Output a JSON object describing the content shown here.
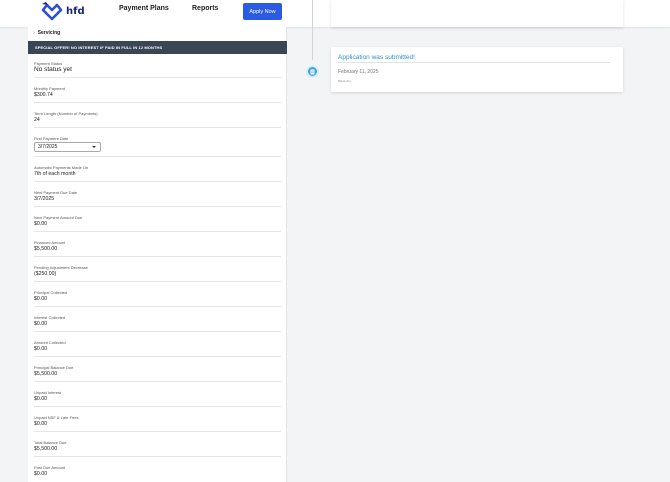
{
  "nav": {
    "logo_text": "hfd",
    "payment_plans": "Payment Plans",
    "reports": "Reports",
    "apply_now": "Apply Now"
  },
  "breadcrumb": {
    "label": "Servicing"
  },
  "offer": {
    "text": "SPECIAL OFFER! NO INTEREST IF PAID IN FULL IN 12 MONTHS"
  },
  "fields": {
    "payment_status": {
      "label": "Payment Status",
      "value": "No status yet"
    },
    "monthly_payment": {
      "label": "Monthly Payment",
      "value": "$300.74"
    },
    "term_length": {
      "label": "Term Length (Number of Payments)",
      "value": "24"
    },
    "first_payment_date": {
      "label": "First Payment Date",
      "value": "3/7/2025"
    },
    "automatic_payments": {
      "label": "Automatic Payments Made On",
      "value": "7th of each month"
    },
    "next_payment_due_date": {
      "label": "Next Payment Due Date",
      "value": "3/7/2025"
    },
    "next_payment_amount_due": {
      "label": "Next Payment Amount Due",
      "value": "$0.00"
    },
    "financed_amount": {
      "label": "Financed Amount",
      "value": "$5,500.00"
    },
    "pending_adjustment": {
      "label": "Pending Adjustment Decrease",
      "value": "($250.00)"
    },
    "principal_collected": {
      "label": "Principal Collected",
      "value": "$0.00"
    },
    "interest_collected": {
      "label": "Interest Collected",
      "value": "$0.00"
    },
    "amount_collected": {
      "label": "Amount Collected",
      "value": "$0.00"
    },
    "principal_balance_due": {
      "label": "Principal Balance Due",
      "value": "$5,500.00"
    },
    "unpaid_interest": {
      "label": "Unpaid Interest",
      "value": "$0.00"
    },
    "unpaid_nsf_late_fees": {
      "label": "Unpaid NSF & Late Fees",
      "value": "$0.00"
    },
    "total_balance_due": {
      "label": "Total Balance Due",
      "value": "$5,500.00"
    },
    "past_due_amount": {
      "label": "Past Due Amount",
      "value": "$0.00"
    }
  },
  "timeline": {
    "event_title": "Application was submitted!",
    "event_date": "February 11, 2025",
    "event_user": "DELLAH"
  },
  "colors": {
    "accent": "#2b5be3",
    "offer_bar": "#3b4654",
    "timeline_title": "#2f8fd0",
    "timeline_icon": "#3aa5e0"
  }
}
